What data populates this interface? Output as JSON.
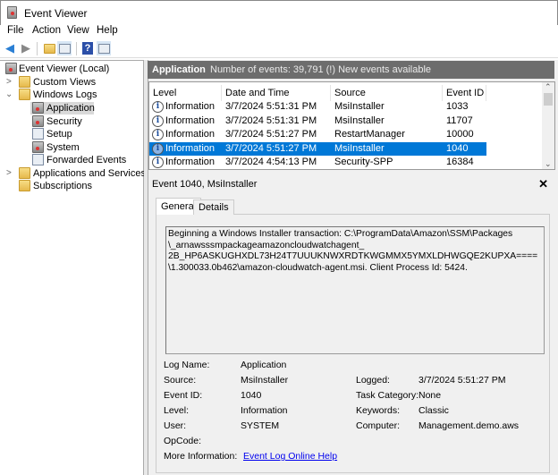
{
  "window": {
    "title": "Event Viewer"
  },
  "menu": [
    "File",
    "Action",
    "View",
    "Help"
  ],
  "toolbar": [
    "back-icon",
    "forward-icon",
    "up-icon",
    "show-hide-console-tree-icon",
    "help-icon",
    "show-hide-action-pane-icon"
  ],
  "tree": {
    "root": "Event Viewer (Local)",
    "items": [
      "Custom Views",
      "Windows Logs",
      "Application",
      "Security",
      "Setup",
      "System",
      "Forwarded Events",
      "Applications and Services Lo",
      "Subscriptions"
    ]
  },
  "header": {
    "title": "Application",
    "status": "Number of events: 39,791 (!) New events available"
  },
  "list": {
    "columns": [
      "Level",
      "Date and Time",
      "Source",
      "Event ID"
    ],
    "rows": [
      {
        "level": "Information",
        "date": "3/7/2024 5:51:31 PM",
        "source": "MsiInstaller",
        "id": "1033"
      },
      {
        "level": "Information",
        "date": "3/7/2024 5:51:31 PM",
        "source": "MsiInstaller",
        "id": "11707"
      },
      {
        "level": "Information",
        "date": "3/7/2024 5:51:27 PM",
        "source": "RestartManager",
        "id": "10000"
      },
      {
        "level": "Information",
        "date": "3/7/2024 5:51:27 PM",
        "source": "MsiInstaller",
        "id": "1040"
      },
      {
        "level": "Information",
        "date": "3/7/2024 4:54:13 PM",
        "source": "Security-SPP",
        "id": "16384"
      }
    ],
    "selected_index": 3
  },
  "details": {
    "title": "Event 1040, MsiInstaller",
    "tabs": [
      "General",
      "Details"
    ],
    "message": [
      "Beginning a Windows Installer transaction: C:\\ProgramData\\Amazon\\SSM\\Packages",
      "\\_arnawsssmpackageamazoncloudwatchagent_",
      "2B_HP6ASKUGHXDL73H24T7UUUKNWXRDTKWGMMX5YMXLDHWGQE2KUPXA====",
      "\\1.300033.0b462\\amazon-cloudwatch-agent.msi. Client Process Id: 5424."
    ],
    "fields": {
      "log_name_label": "Log Name:",
      "log_name": "Application",
      "source_label": "Source:",
      "source": "MsiInstaller",
      "event_id_label": "Event ID:",
      "event_id": "1040",
      "level_label": "Level:",
      "level": "Information",
      "user_label": "User:",
      "user": "SYSTEM",
      "opcode_label": "OpCode:",
      "more_info_label": "More Information:",
      "more_info_link": "Event Log Online Help",
      "logged_label": "Logged:",
      "logged": "3/7/2024 5:51:27 PM",
      "task_label": "Task Category:",
      "task": "None",
      "keywords_label": "Keywords:",
      "keywords": "Classic",
      "computer_label": "Computer:",
      "computer": "Management.demo.aws"
    }
  },
  "colors": {
    "selection": "#0078d7",
    "header": "#6d6d6d",
    "link": "#0000ee"
  }
}
